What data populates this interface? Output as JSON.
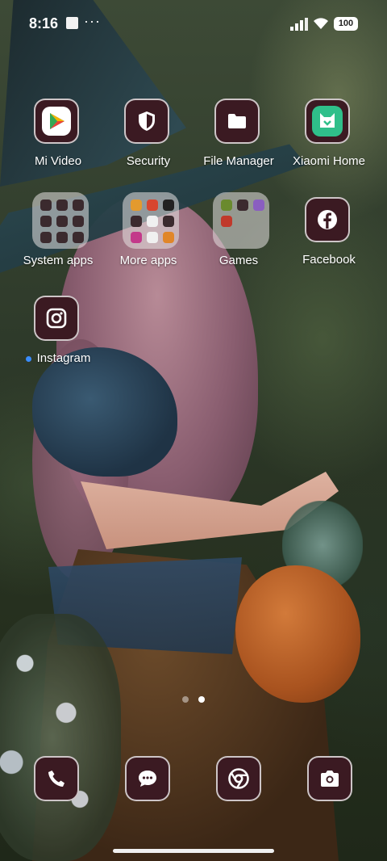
{
  "status_bar": {
    "time": "8:16",
    "overflow_indicator": "···",
    "battery_level": "100",
    "icons": [
      "notification-square-icon",
      "signal-icon",
      "wifi-icon",
      "battery-icon"
    ]
  },
  "apps": [
    {
      "label": "Mi Video",
      "icon": "mi-video-icon"
    },
    {
      "label": "Security",
      "icon": "security-shield-icon"
    },
    {
      "label": "File Manager",
      "icon": "folder-icon"
    },
    {
      "label": "Xiaomi Home",
      "icon": "xiaomi-home-icon"
    },
    {
      "label": "System apps",
      "icon": "folder-grid-icon"
    },
    {
      "label": "More apps",
      "icon": "folder-grid-icon"
    },
    {
      "label": "Games",
      "icon": "folder-grid-icon"
    },
    {
      "label": "Facebook",
      "icon": "facebook-icon"
    },
    {
      "label": "Instagram",
      "icon": "instagram-icon",
      "new_indicator": true
    }
  ],
  "pager": {
    "pages": 2,
    "current": 2
  },
  "dock": [
    {
      "name": "phone",
      "icon": "phone-icon"
    },
    {
      "name": "messages",
      "icon": "message-icon"
    },
    {
      "name": "chrome",
      "icon": "chrome-icon"
    },
    {
      "name": "camera",
      "icon": "camera-icon"
    }
  ],
  "colors": {
    "icon_bg": "#3b1a22",
    "icon_border": "#ffffff",
    "new_dot": "#3a8dff",
    "xiaomi_home_green": "#2fbf8a"
  }
}
